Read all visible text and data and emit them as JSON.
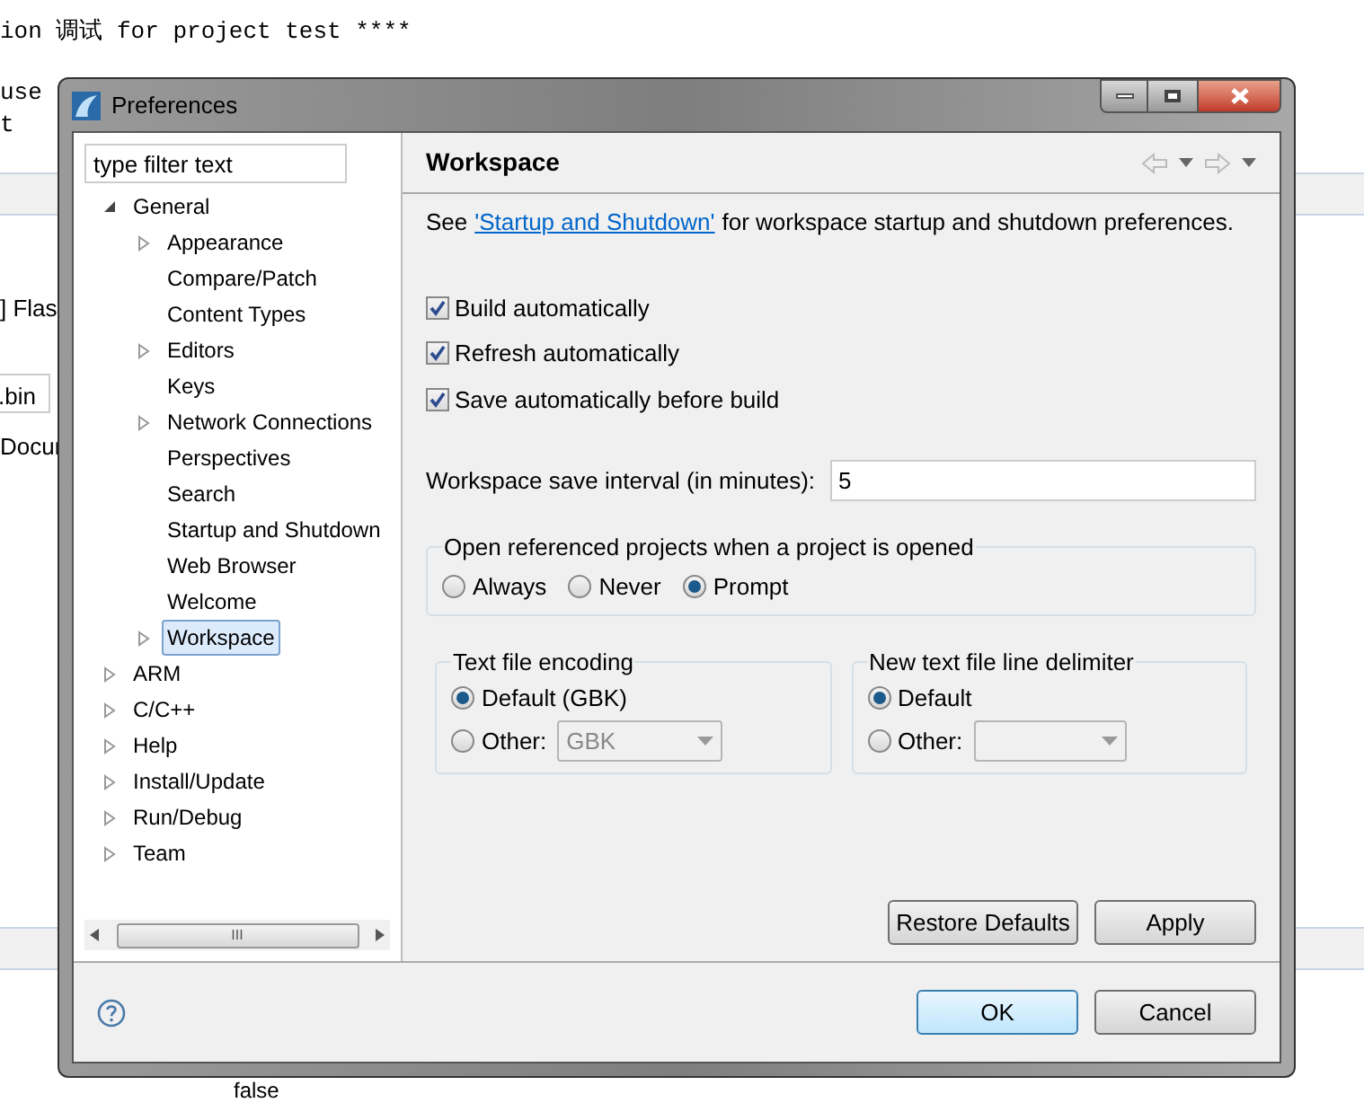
{
  "background": {
    "console_line": "ion 调试 for project test ****",
    "fragment_1": "use",
    "fragment_2": "t",
    "fragment_3": "] Flas",
    "fragment_4": ".bin",
    "fragment_5": "Docur",
    "fragment_6": "false"
  },
  "window": {
    "title": "Preferences"
  },
  "filter": {
    "placeholder": "type filter text"
  },
  "tree": [
    {
      "label": "General",
      "expanded": true,
      "selected": false,
      "children": [
        {
          "label": "Appearance",
          "has_children": true,
          "selected": false
        },
        {
          "label": "Compare/Patch",
          "has_children": false,
          "selected": false
        },
        {
          "label": "Content Types",
          "has_children": false,
          "selected": false
        },
        {
          "label": "Editors",
          "has_children": true,
          "selected": false
        },
        {
          "label": "Keys",
          "has_children": false,
          "selected": false
        },
        {
          "label": "Network Connections",
          "has_children": true,
          "selected": false
        },
        {
          "label": "Perspectives",
          "has_children": false,
          "selected": false
        },
        {
          "label": "Search",
          "has_children": false,
          "selected": false
        },
        {
          "label": "Startup and Shutdown",
          "has_children": false,
          "selected": false
        },
        {
          "label": "Web Browser",
          "has_children": false,
          "selected": false
        },
        {
          "label": "Welcome",
          "has_children": false,
          "selected": false
        },
        {
          "label": "Workspace",
          "has_children": true,
          "selected": true
        }
      ]
    },
    {
      "label": "ARM",
      "expanded": false,
      "selected": false
    },
    {
      "label": "C/C++",
      "expanded": false,
      "selected": false
    },
    {
      "label": "Help",
      "expanded": false,
      "selected": false
    },
    {
      "label": "Install/Update",
      "expanded": false,
      "selected": false
    },
    {
      "label": "Run/Debug",
      "expanded": false,
      "selected": false
    },
    {
      "label": "Team",
      "expanded": false,
      "selected": false
    }
  ],
  "scrollbar_grip": "III",
  "page": {
    "title": "Workspace",
    "intro_before": "See",
    "intro_link": "'Startup and Shutdown'",
    "intro_after": "for workspace startup and shutdown preferences.",
    "checkboxes": [
      {
        "label": "Build automatically",
        "checked": true
      },
      {
        "label": "Refresh automatically",
        "checked": true
      },
      {
        "label": "Save automatically before build",
        "checked": true
      }
    ],
    "interval": {
      "label": "Workspace save interval (in minutes):",
      "value": "5"
    },
    "open_projects": {
      "title": "Open referenced projects when a project is opened",
      "options": [
        {
          "label": "Always",
          "selected": false
        },
        {
          "label": "Never",
          "selected": false
        },
        {
          "label": "Prompt",
          "selected": true
        }
      ]
    },
    "encoding": {
      "title": "Text file encoding",
      "default": {
        "label": "Default (GBK)",
        "selected": true
      },
      "other": {
        "label": "Other:",
        "selected": false,
        "value": "GBK"
      }
    },
    "delimiter": {
      "title": "New text file line delimiter",
      "default": {
        "label": "Default",
        "selected": true
      },
      "other": {
        "label": "Other:",
        "selected": false
      }
    },
    "buttons": [
      "Restore Defaults",
      "Apply"
    ]
  },
  "dialog_buttons": [
    {
      "label": "OK",
      "default": true
    },
    {
      "label": "Cancel",
      "default": false
    }
  ]
}
